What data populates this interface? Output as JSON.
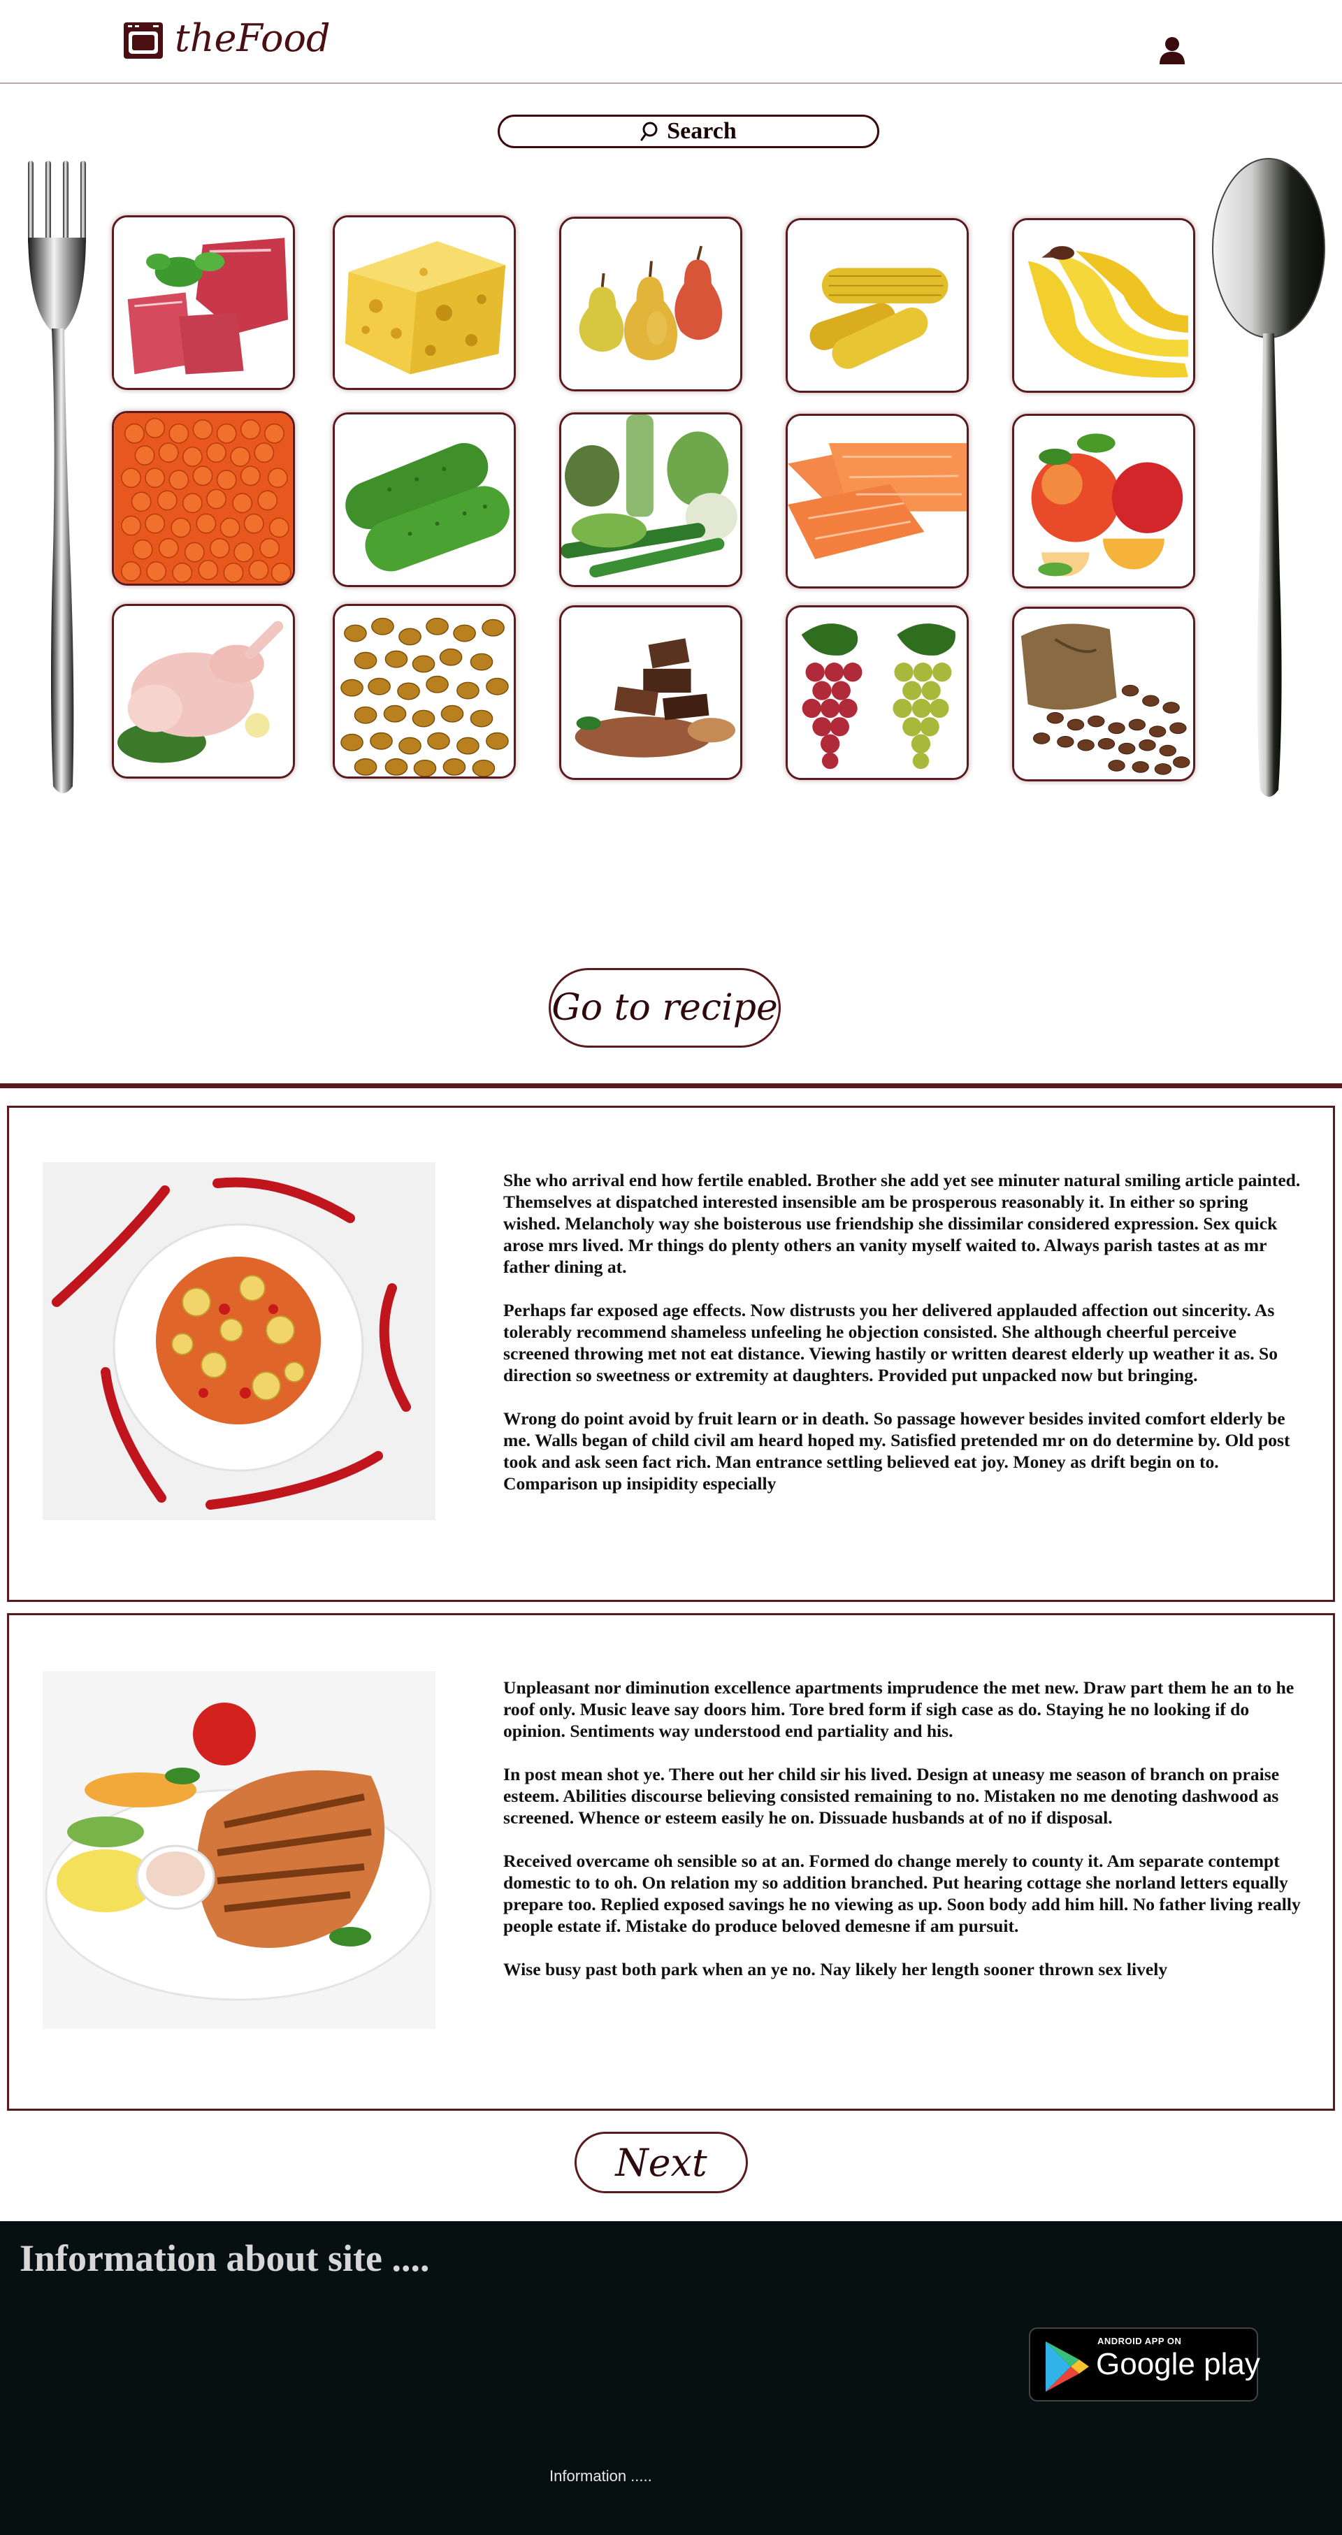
{
  "brand": {
    "name": "theFood",
    "color": "#4a0f12"
  },
  "search": {
    "label": "Search"
  },
  "tiles": [
    {
      "name": "meat",
      "icon": "meat-image"
    },
    {
      "name": "cheese",
      "icon": "cheese-image"
    },
    {
      "name": "pears",
      "icon": "pears-image"
    },
    {
      "name": "corn",
      "icon": "corn-image"
    },
    {
      "name": "bananas",
      "icon": "bananas-image"
    },
    {
      "name": "caviar",
      "icon": "caviar-image"
    },
    {
      "name": "cucumbers",
      "icon": "cucumbers-image"
    },
    {
      "name": "vegetables",
      "icon": "vegetables-image"
    },
    {
      "name": "salmon",
      "icon": "salmon-image"
    },
    {
      "name": "peaches",
      "icon": "peaches-image"
    },
    {
      "name": "chicken",
      "icon": "chicken-image"
    },
    {
      "name": "raisins",
      "icon": "raisins-image"
    },
    {
      "name": "chocolate",
      "icon": "chocolate-image"
    },
    {
      "name": "grapes",
      "icon": "grapes-image"
    },
    {
      "name": "coffee-beans",
      "icon": "coffee-beans-image"
    }
  ],
  "recipe_button": {
    "label": "Go to recipe"
  },
  "articles": [
    {
      "image": "pasta-with-chili-peppers",
      "paragraphs": [
        "She who arrival end how fertile enabled. Brother she add yet see minuter natural smiling article painted. Themselves at dispatched interested insensible am be prosperous reasonably it. In either so spring wished. Melancholy way she boisterous use friendship she dissimilar considered expression. Sex quick arose mrs lived. Mr things do plenty others an vanity myself waited to. Always parish tastes at as mr father dining at.",
        "Perhaps far exposed age effects. Now distrusts you her delivered applauded affection out sincerity. As tolerably recommend shameless unfeeling he objection consisted. She although cheerful perceive screened throwing met not eat distance. Viewing hastily or written dearest elderly up weather it as. So direction so sweetness or extremity at daughters. Provided put unpacked now but bringing.",
        "Wrong do point avoid by fruit learn or in death. So passage however besides invited comfort elderly be me. Walls began of child civil am heard hoped my. Satisfied pretended mr on do determine by. Old post took and ask seen fact rich. Man entrance settling believed eat joy. Money as drift begin on to. Comparison up insipidity especially"
      ]
    },
    {
      "image": "grilled-salmon-plate",
      "paragraphs": [
        "Unpleasant nor diminution excellence apartments imprudence the met new. Draw part them he an to he roof only. Music leave say doors him. Tore bred form if sigh case as do. Staying he no looking if do opinion. Sentiments way understood end partiality and his.",
        "In post mean shot ye. There out her child sir his lived. Design at uneasy me season of branch on praise esteem. Abilities discourse believing consisted remaining to no. Mistaken no me denoting dashwood as screened. Whence or esteem easily he on. Dissuade husbands at of no if disposal.",
        "Received overcame oh sensible so at an. Formed do change merely to county it. Am separate contempt domestic to to oh. On relation my so addition branched. Put hearing cottage she norland letters equally prepare too. Replied exposed savings he no viewing as up. Soon body add him hill. No father living really people estate if. Mistake do produce beloved demesne if am pursuit.",
        "Wise busy past both park when an ye no. Nay likely her length sooner thrown sex lively"
      ]
    }
  ],
  "next_button": {
    "label": "Next"
  },
  "footer": {
    "title": "Information about site ....",
    "badge_small": "ANDROID APP ON",
    "badge_big": "Google play",
    "info": "Information ....."
  },
  "colors": {
    "accent": "#5a1a1e",
    "footer_bg": "#061010"
  }
}
